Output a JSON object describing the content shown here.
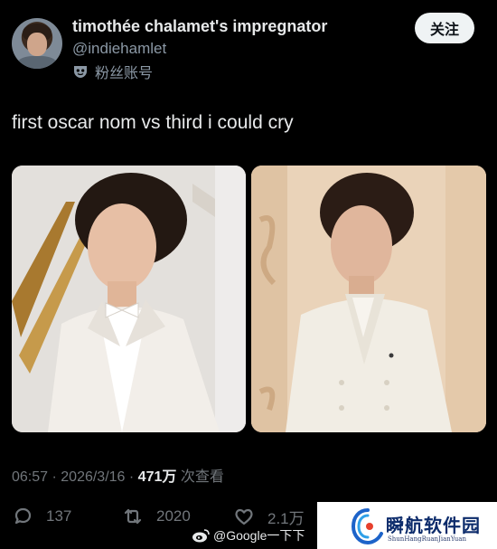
{
  "author": {
    "display_name": "timothée chalamet's impregnator",
    "handle": "@indiehamlet",
    "fan_label": "粉丝账号",
    "avatar_icon": "avatar-photo"
  },
  "follow_button": "关注",
  "tweet": {
    "text": "first oscar nom vs third i could cry"
  },
  "media": [
    {
      "label": "photo-left-white-tuxedo"
    },
    {
      "label": "photo-right-white-double-breasted-suit"
    }
  ],
  "meta": {
    "time": "06:57",
    "separator": " · ",
    "date": "2026/3/16",
    "views_count": "471万",
    "views_label": " 次查看"
  },
  "actions": {
    "replies": "137",
    "retweets": "2020",
    "likes": "2.1万"
  },
  "watermarks": {
    "google": "@Google一下下",
    "site_title": "瞬航软件园",
    "site_subtitle": "ShunHangRuanJianYuan"
  },
  "colors": {
    "background": "#000000",
    "primary_text": "#e7e9ea",
    "secondary_text": "#71767b",
    "follow_bg": "#eff3f4"
  }
}
